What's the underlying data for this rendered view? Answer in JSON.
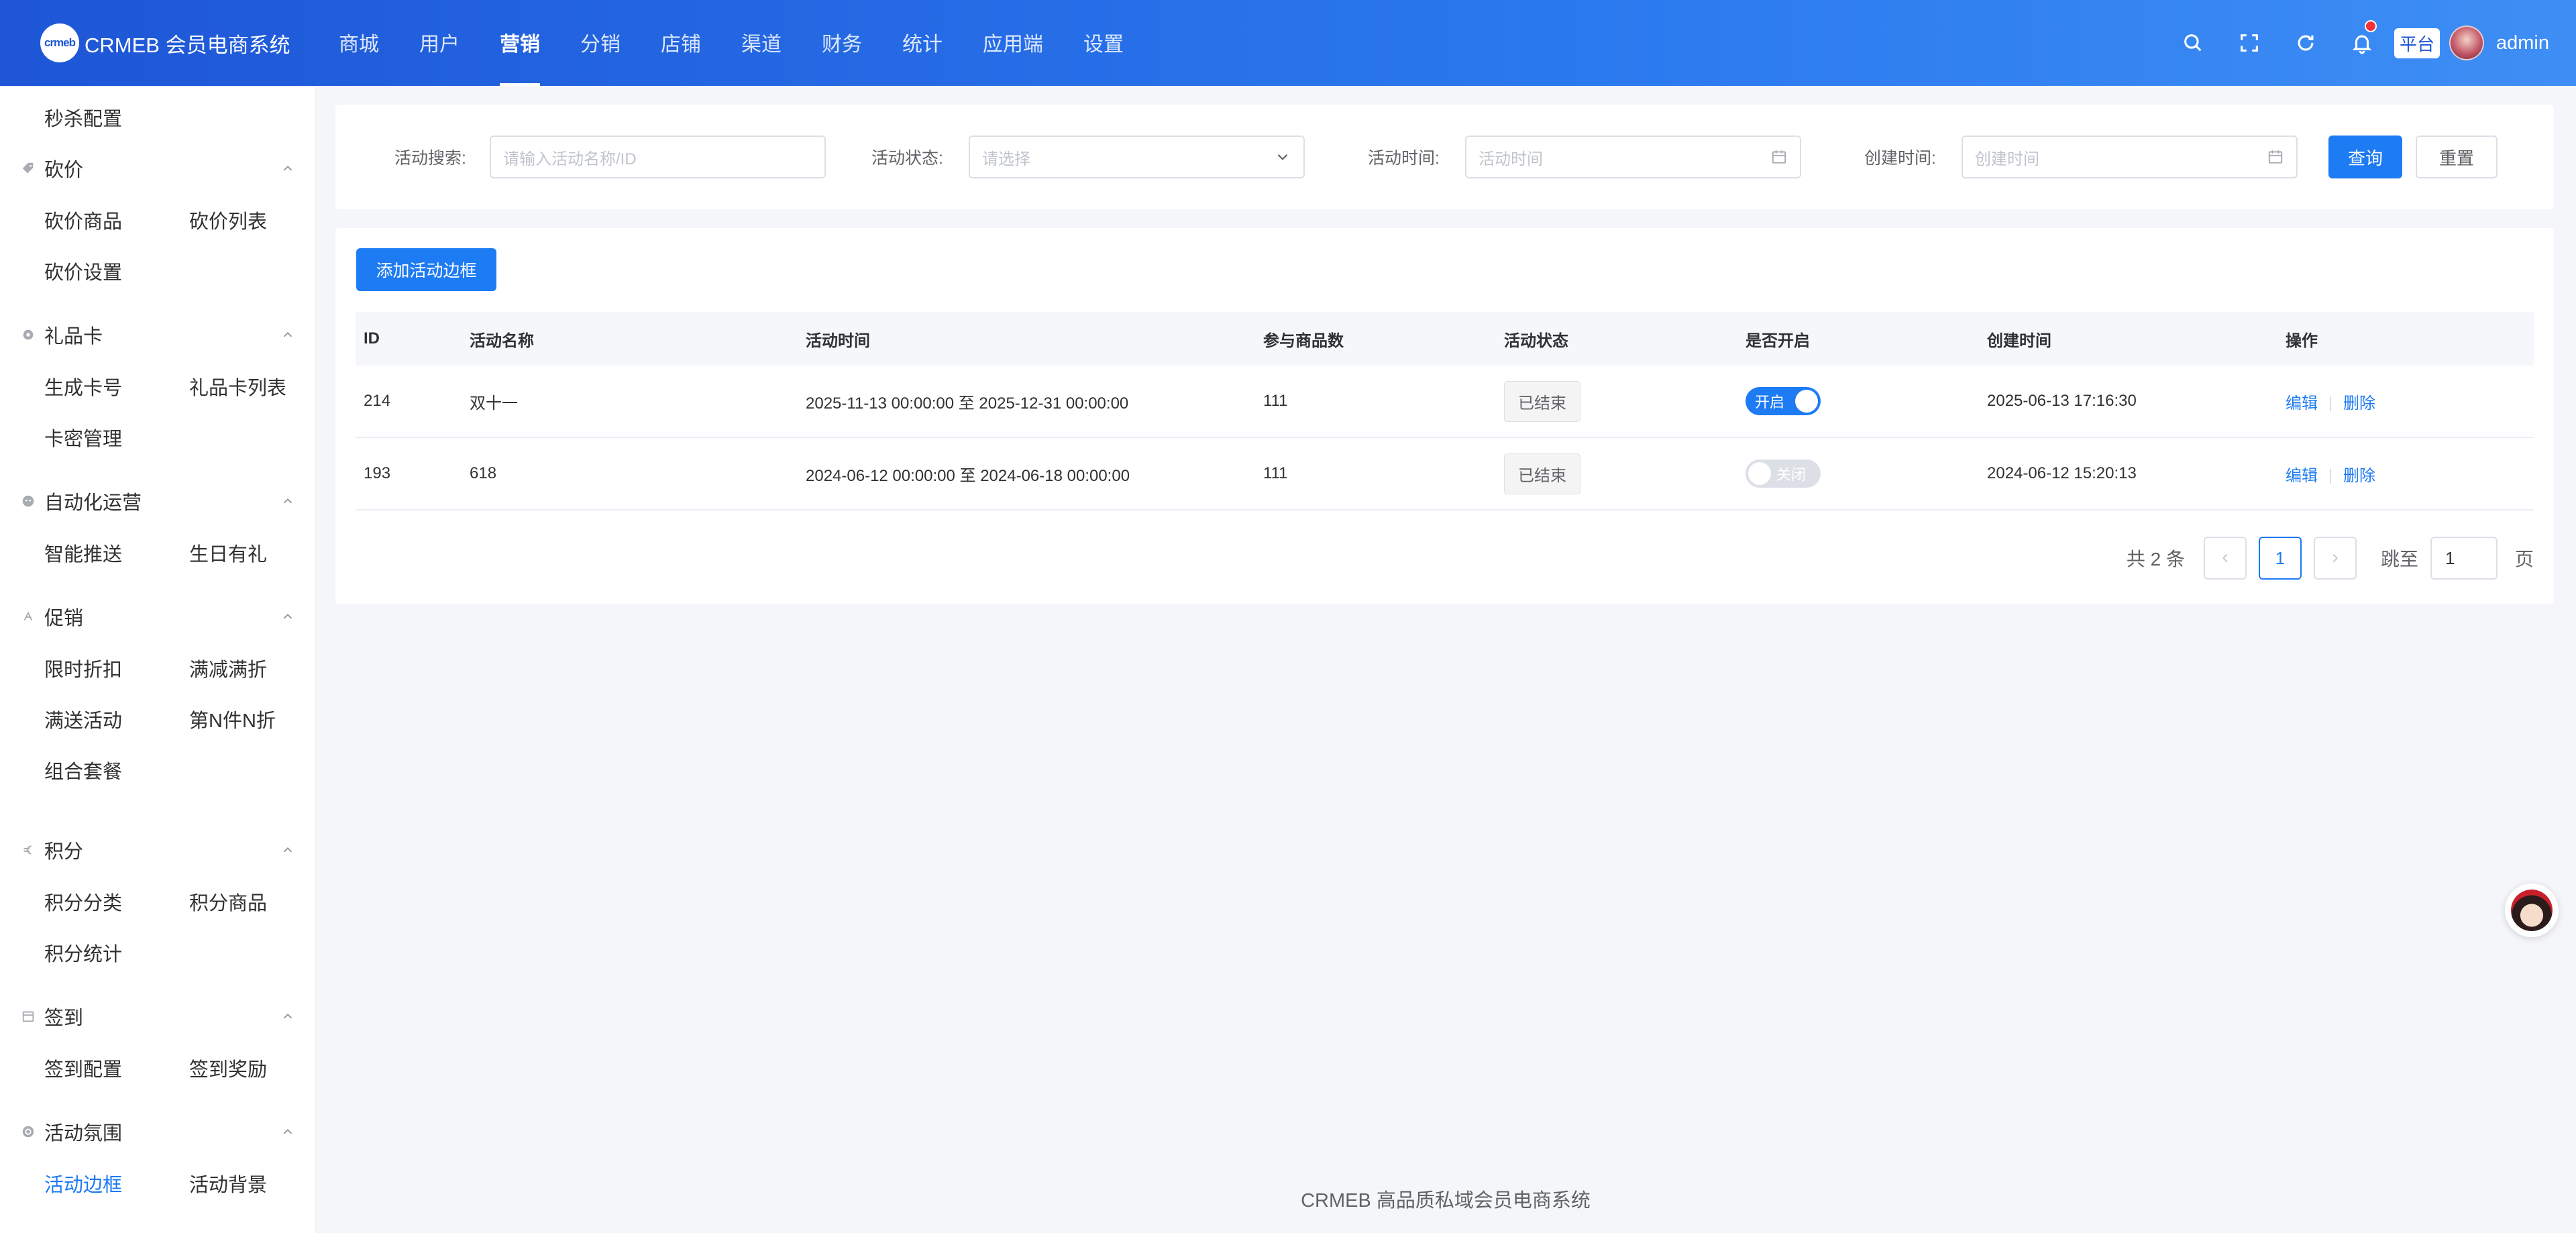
{
  "header": {
    "logo_text": "CRMEB 会员电商系统",
    "logo_mark": "crmeb",
    "nav": [
      "商城",
      "用户",
      "营销",
      "分销",
      "店铺",
      "渠道",
      "财务",
      "统计",
      "应用端",
      "设置"
    ],
    "active_nav": "营销",
    "platform_badge": "平台",
    "user_name": "admin",
    "icons": [
      "search-icon",
      "fullscreen-icon",
      "refresh-icon",
      "bell-icon"
    ]
  },
  "sidebar": {
    "top_item": "秒杀配置",
    "groups": [
      {
        "title": "砍价",
        "icon": "tag-icon",
        "items": [
          "砍价商品",
          "砍价列表",
          "砍价设置"
        ]
      },
      {
        "title": "礼品卡",
        "icon": "gear-icon",
        "items": [
          "生成卡号",
          "礼品卡列表",
          "卡密管理"
        ]
      },
      {
        "title": "自动化运营",
        "icon": "robot-icon",
        "items": [
          "智能推送",
          "生日有礼"
        ]
      },
      {
        "title": "促销",
        "icon": "promo-icon",
        "items": [
          "限时折扣",
          "满减满折",
          "满送活动",
          "第N件N折",
          "组合套餐"
        ]
      },
      {
        "title": "积分",
        "icon": "euro-icon",
        "items": [
          "积分分类",
          "积分商品",
          "积分统计"
        ]
      },
      {
        "title": "签到",
        "icon": "calendar-icon",
        "items": [
          "签到配置",
          "签到奖励"
        ]
      },
      {
        "title": "活动氛围",
        "icon": "circle-icon",
        "items": [
          "活动边框",
          "活动背景"
        ]
      }
    ],
    "active_item": "活动边框"
  },
  "search": {
    "keyword_label": "活动搜索:",
    "keyword_placeholder": "请输入活动名称/ID",
    "status_label": "活动状态:",
    "status_placeholder": "请选择",
    "time_label": "活动时间:",
    "time_placeholder": "活动时间",
    "created_label": "创建时间:",
    "created_placeholder": "创建时间",
    "query_button": "查询",
    "reset_button": "重置"
  },
  "table": {
    "add_button": "添加活动边框",
    "columns": [
      "ID",
      "活动名称",
      "活动时间",
      "参与商品数",
      "活动状态",
      "是否开启",
      "创建时间",
      "操作"
    ],
    "rows": [
      {
        "id": "214",
        "name": "双十一",
        "time": "2025-11-13 00:00:00 至 2025-12-31 00:00:00",
        "count": "111",
        "status": "已结束",
        "enabled": true,
        "switch_label": "开启",
        "created": "2025-06-13 17:16:30",
        "edit": "编辑",
        "delete": "删除"
      },
      {
        "id": "193",
        "name": "618",
        "time": "2024-06-12 00:00:00 至 2024-06-18 00:00:00",
        "count": "111",
        "status": "已结束",
        "enabled": false,
        "switch_label": "关闭",
        "created": "2024-06-12 15:20:13",
        "edit": "编辑",
        "delete": "删除"
      }
    ]
  },
  "pagination": {
    "total_text": "共 2 条",
    "current_page": "1",
    "jump_label": "跳至",
    "jump_value": "1",
    "page_unit": "页"
  },
  "footer": "CRMEB 高品质私域会员电商系统",
  "colors": {
    "primary": "#1d7bf3",
    "header_start": "#1e56d6",
    "header_end": "#3e8ef5"
  }
}
